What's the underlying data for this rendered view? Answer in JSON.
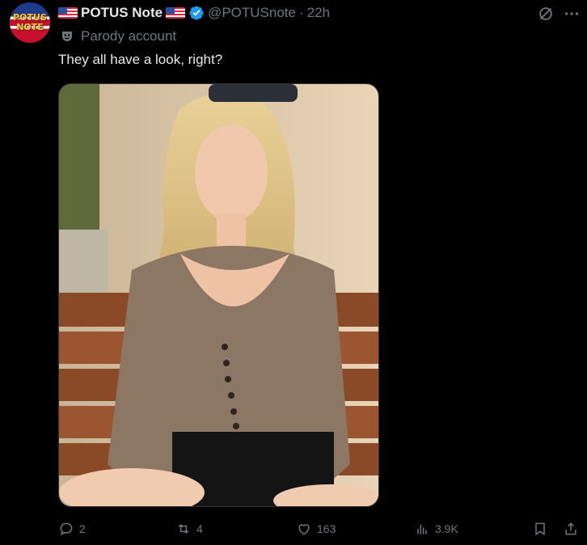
{
  "author": {
    "avatar_text_line1": "POTUS",
    "avatar_text_line2": "NOTE",
    "display_name": "POTUS Note",
    "handle": "@POTUSnote",
    "separator": "·",
    "time": "22h",
    "label": "Parody account"
  },
  "tweet": {
    "text": "They all have a look, right?"
  },
  "media": {
    "icon": "photo-image"
  },
  "actions": {
    "replies": "2",
    "reposts": "4",
    "likes": "163",
    "views": "3.9K"
  },
  "colors": {
    "background": "#000000",
    "text": "#e7e9ea",
    "secondary": "#71767b",
    "verified": "#1d9bf0"
  }
}
